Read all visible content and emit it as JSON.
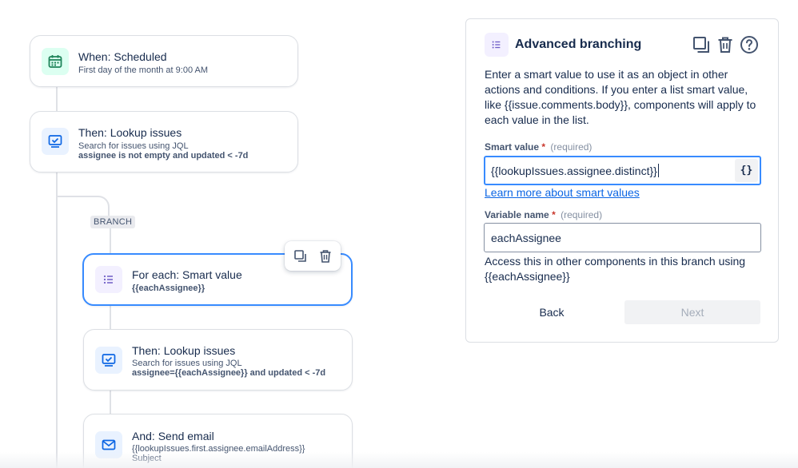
{
  "flow": {
    "branch_label": "BRANCH",
    "trigger": {
      "title": "When: Scheduled",
      "subtitle": "First day of the month at 9:00 AM"
    },
    "lookup1": {
      "title": "Then: Lookup issues",
      "subtitle": "Search for issues using JQL",
      "jql": "assignee is not empty and updated < -7d"
    },
    "foreach": {
      "title": "For each: Smart value",
      "variable": "{{eachAssignee}}"
    },
    "lookup2": {
      "title": "Then: Lookup issues",
      "subtitle": "Search for issues using JQL",
      "jql": "assignee={{eachAssignee}} and updated < -7d"
    },
    "email": {
      "title": "And: Send email",
      "to": "{{lookupIssues.first.assignee.emailAddress}}",
      "subject_label": "Subject"
    }
  },
  "panel": {
    "title": "Advanced branching",
    "description": "Enter a smart value to use it as an object in other actions and conditions. If you enter a list smart value, like {{issue.comments.body}}, components will apply to each value in the list.",
    "smart_value": {
      "label": "Smart value",
      "required_mark": "*",
      "hint": "(required)",
      "value": "{{lookupIssues.assignee.distinct}}",
      "braces": "{}"
    },
    "learn_more": "Learn more about smart values",
    "variable_name": {
      "label": "Variable name",
      "required_mark": "*",
      "hint": "(required)",
      "value": "eachAssignee"
    },
    "helper": "Access this in other components in this branch using {{eachAssignee}}",
    "back_label": "Back",
    "next_label": "Next"
  },
  "colors": {
    "accent": "#388bff",
    "link": "#0c66e4",
    "required": "#c9372c"
  }
}
